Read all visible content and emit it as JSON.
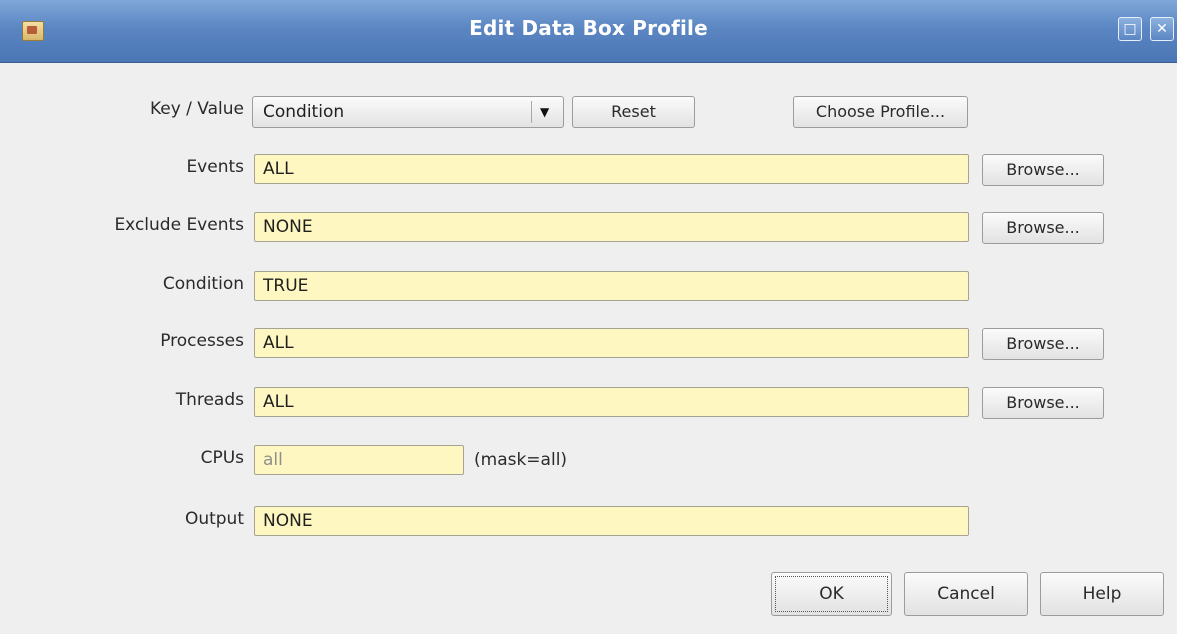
{
  "window": {
    "title": "Edit Data Box Profile",
    "icons": {
      "app": "app-icon",
      "maximize": "maximize-icon",
      "close": "close-icon"
    },
    "title_gradient": [
      "#7fa7d9",
      "#4a76b5"
    ]
  },
  "form": {
    "key_value": {
      "label": "Key / Value",
      "selected": "Condition",
      "dropdown_icon": "chevron-down-icon",
      "reset_label": "Reset",
      "choose_profile_label": "Choose Profile..."
    },
    "events": {
      "label": "Events",
      "value": "ALL",
      "browse_label": "Browse..."
    },
    "exclude_events": {
      "label": "Exclude Events",
      "value": "NONE",
      "browse_label": "Browse..."
    },
    "condition": {
      "label": "Condition",
      "value": "TRUE"
    },
    "processes": {
      "label": "Processes",
      "value": "ALL",
      "browse_label": "Browse..."
    },
    "threads": {
      "label": "Threads",
      "value": "ALL",
      "browse_label": "Browse..."
    },
    "cpus": {
      "label": "CPUs",
      "value": "all",
      "mask_note": "(mask=all)"
    },
    "output": {
      "label": "Output",
      "value": "NONE"
    }
  },
  "footer": {
    "ok_label": "OK",
    "cancel_label": "Cancel",
    "help_label": "Help"
  },
  "colors": {
    "field_background": "#fff7c2",
    "window_background": "#efefef"
  }
}
